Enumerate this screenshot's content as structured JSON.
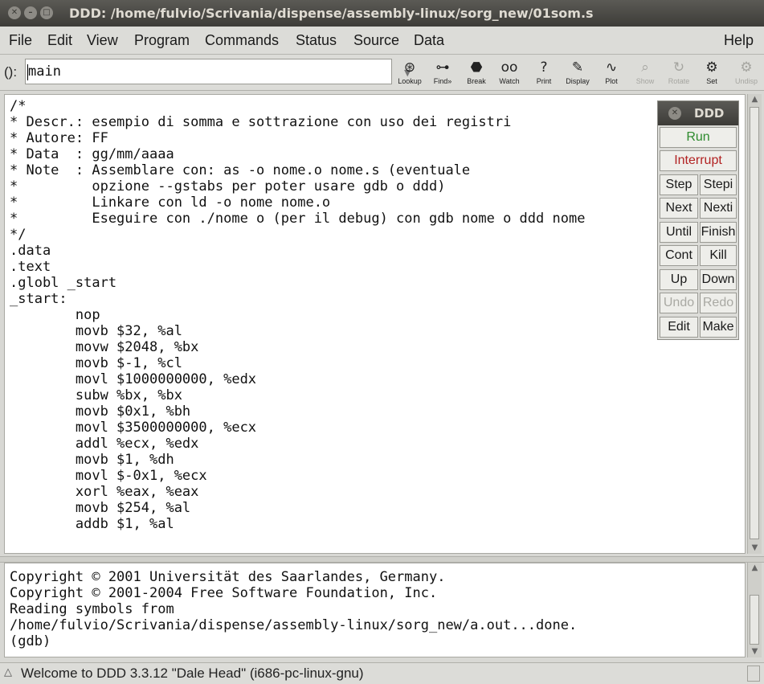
{
  "window": {
    "title": "DDD: /home/fulvio/Scrivania/dispense/assembly-linux/sorg_new/01som.s",
    "buttons": [
      "close-icon",
      "minimize-icon",
      "maximize-icon"
    ]
  },
  "menubar": {
    "items": [
      "File",
      "Edit",
      "View",
      "Program",
      "Commands",
      "Status",
      "Source",
      "Data"
    ],
    "help": "Help"
  },
  "toolbar": {
    "arg_label": "():",
    "arg_value": "main",
    "tools": [
      {
        "label": "Lookup",
        "icon": "lookup-icon",
        "enabled": true
      },
      {
        "label": "Find»",
        "icon": "binoculars-icon",
        "enabled": true
      },
      {
        "label": "Break",
        "icon": "stop-sign-icon",
        "enabled": true
      },
      {
        "label": "Watch",
        "icon": "glasses-icon",
        "enabled": true
      },
      {
        "label": "Print",
        "icon": "question-icon",
        "enabled": true
      },
      {
        "label": "Display",
        "icon": "display-icon",
        "enabled": true
      },
      {
        "label": "Plot",
        "icon": "plot-icon",
        "enabled": true
      },
      {
        "label": "Show",
        "icon": "magnifier-icon",
        "enabled": false
      },
      {
        "label": "Rotate",
        "icon": "rotate-icon",
        "enabled": false
      },
      {
        "label": "Set",
        "icon": "set-icon",
        "enabled": true
      },
      {
        "label": "Undisp",
        "icon": "undisplay-icon",
        "enabled": false
      }
    ]
  },
  "source": {
    "lines": [
      "/*",
      "* Descr.: esempio di somma e sottrazione con uso dei registri",
      "* Autore: FF",
      "* Data  : gg/mm/aaaa",
      "* Note  : Assemblare con: as -o nome.o nome.s (eventuale",
      "*         opzione --gstabs per poter usare gdb o ddd)",
      "*         Linkare con ld -o nome nome.o",
      "*         Eseguire con ./nome o (per il debug) con gdb nome o ddd nome",
      "*/",
      ".data",
      ".text",
      ".globl _start",
      "_start:",
      "        nop",
      "        movb $32, %al",
      "        movw $2048, %bx",
      "        movb $-1, %cl",
      "        movl $1000000000, %edx",
      "        subw %bx, %bx",
      "        movb $0x1, %bh",
      "        movl $3500000000, %ecx",
      "        addl %ecx, %edx",
      "        movb $1, %dh",
      "        movl $-0x1, %ecx",
      "        xorl %eax, %eax",
      "        movb $254, %al",
      "        addb $1, %al"
    ]
  },
  "command_tool": {
    "title": "DDD",
    "run": "Run",
    "interrupt": "Interrupt",
    "run_color": "#2e8b2e",
    "interrupt_color": "#b22222",
    "rows": [
      [
        "Step",
        "Stepi"
      ],
      [
        "Next",
        "Nexti"
      ],
      [
        "Until",
        "Finish"
      ],
      [
        "Cont",
        "Kill"
      ],
      [
        "Up",
        "Down"
      ],
      [
        "Undo",
        "Redo"
      ],
      [
        "Edit",
        "Make"
      ]
    ],
    "disabled": [
      "Undo",
      "Redo"
    ]
  },
  "console": {
    "lines": [
      "Copyright © 2001 Universität des Saarlandes, Germany.",
      "Copyright © 2001-2004 Free Software Foundation, Inc.",
      "Reading symbols from",
      "/home/fulvio/Scrivania/dispense/assembly-linux/sorg_new/a.out...done.",
      "(gdb)"
    ]
  },
  "status": {
    "text": "Welcome to DDD 3.3.12 \"Dale Head\" (i686-pc-linux-gnu)"
  }
}
